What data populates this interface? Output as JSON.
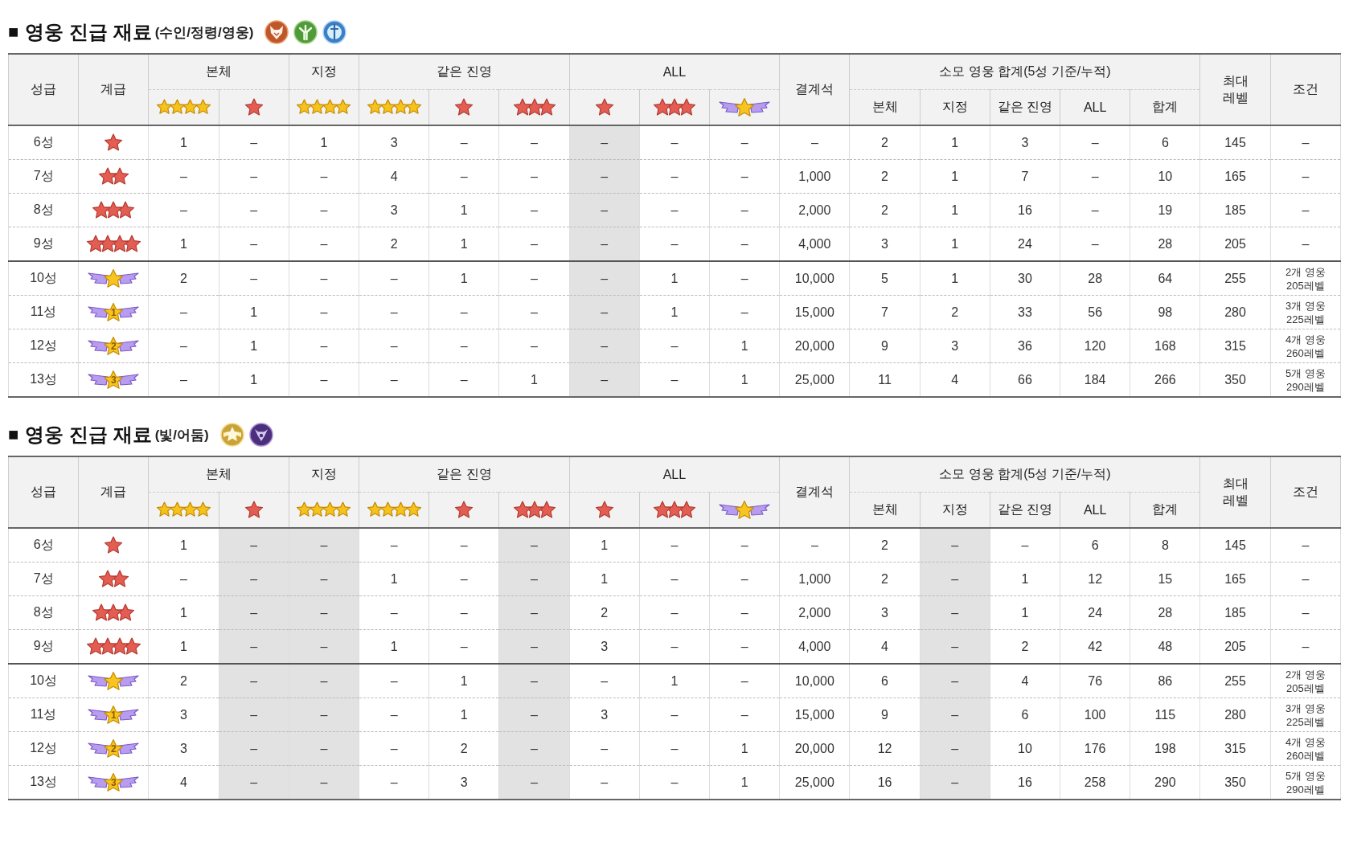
{
  "sections": [
    {
      "bullet": "■",
      "title": "영웅 진급 재료",
      "subtitle": "(수인/정령/영웅)",
      "emblems": [
        {
          "kind": "beast"
        },
        {
          "kind": "forest"
        },
        {
          "kind": "shield"
        }
      ],
      "table": {
        "grade": "성급",
        "rank": "계급",
        "groups": [
          {
            "label": "본체",
            "columns": [
              {
                "kind": "gold-4",
                "shaded": false
              },
              {
                "kind": "red-1",
                "shaded": false
              }
            ]
          },
          {
            "label": "지정",
            "columns": [
              {
                "kind": "gold-4",
                "shaded": false
              }
            ]
          },
          {
            "label": "같은 진영",
            "columns": [
              {
                "kind": "gold-4",
                "shaded": false
              },
              {
                "kind": "red-1",
                "shaded": false
              },
              {
                "kind": "red-3",
                "shaded": false
              }
            ]
          },
          {
            "label": "ALL",
            "columns": [
              {
                "kind": "red-1",
                "shaded": true
              },
              {
                "kind": "red-3",
                "shaded": false
              },
              {
                "kind": "wing",
                "shaded": false
              }
            ]
          }
        ],
        "crystal": "결계석",
        "totals": {
          "label": "소모 영웅 합계(5성 기준/누적)",
          "columns": [
            {
              "label": "본체",
              "shaded": false
            },
            {
              "label": "지정",
              "shaded": false
            },
            {
              "label": "같은 진영",
              "shaded": false
            },
            {
              "label": "ALL",
              "shaded": false
            },
            {
              "label": "합계",
              "shaded": false
            }
          ]
        },
        "max_level": [
          "최대",
          "레벨"
        ],
        "condition": "조건",
        "row_groups": [
          {
            "rows": [
              {
                "grade": "6성",
                "rank": {
                  "kind": "red-1"
                },
                "materials": [
                  "1",
                  "–",
                  "1",
                  "3",
                  "–",
                  "–",
                  "–",
                  "–",
                  "–"
                ],
                "crystal": "–",
                "totals": [
                  "2",
                  "1",
                  "3",
                  "–",
                  "6"
                ],
                "max_level": "145",
                "condition": [
                  "–"
                ]
              },
              {
                "grade": "7성",
                "rank": {
                  "kind": "red-2"
                },
                "materials": [
                  "–",
                  "–",
                  "–",
                  "4",
                  "–",
                  "–",
                  "–",
                  "–",
                  "–"
                ],
                "crystal": "1,000",
                "totals": [
                  "2",
                  "1",
                  "7",
                  "–",
                  "10"
                ],
                "max_level": "165",
                "condition": [
                  "–"
                ]
              },
              {
                "grade": "8성",
                "rank": {
                  "kind": "red-3"
                },
                "materials": [
                  "–",
                  "–",
                  "–",
                  "3",
                  "1",
                  "–",
                  "–",
                  "–",
                  "–"
                ],
                "crystal": "2,000",
                "totals": [
                  "2",
                  "1",
                  "16",
                  "–",
                  "19"
                ],
                "max_level": "185",
                "condition": [
                  "–"
                ]
              },
              {
                "grade": "9성",
                "rank": {
                  "kind": "red-4"
                },
                "materials": [
                  "1",
                  "–",
                  "–",
                  "2",
                  "1",
                  "–",
                  "–",
                  "–",
                  "–"
                ],
                "crystal": "4,000",
                "totals": [
                  "3",
                  "1",
                  "24",
                  "–",
                  "28"
                ],
                "max_level": "205",
                "condition": [
                  "–"
                ]
              }
            ]
          },
          {
            "rows": [
              {
                "grade": "10성",
                "rank": {
                  "kind": "wing"
                },
                "materials": [
                  "2",
                  "–",
                  "–",
                  "–",
                  "1",
                  "–",
                  "–",
                  "1",
                  "–"
                ],
                "crystal": "10,000",
                "totals": [
                  "5",
                  "1",
                  "30",
                  "28",
                  "64"
                ],
                "max_level": "255",
                "condition": [
                  "2개 영웅",
                  "205레벨"
                ]
              },
              {
                "grade": "11성",
                "rank": {
                  "kind": "wing",
                  "number": "1"
                },
                "materials": [
                  "–",
                  "1",
                  "–",
                  "–",
                  "–",
                  "–",
                  "–",
                  "1",
                  "–"
                ],
                "crystal": "15,000",
                "totals": [
                  "7",
                  "2",
                  "33",
                  "56",
                  "98"
                ],
                "max_level": "280",
                "condition": [
                  "3개 영웅",
                  "225레벨"
                ]
              },
              {
                "grade": "12성",
                "rank": {
                  "kind": "wing",
                  "number": "2"
                },
                "materials": [
                  "–",
                  "1",
                  "–",
                  "–",
                  "–",
                  "–",
                  "–",
                  "–",
                  "1"
                ],
                "crystal": "20,000",
                "totals": [
                  "9",
                  "3",
                  "36",
                  "120",
                  "168"
                ],
                "max_level": "315",
                "condition": [
                  "4개 영웅",
                  "260레벨"
                ]
              },
              {
                "grade": "13성",
                "rank": {
                  "kind": "wing",
                  "number": "3"
                },
                "materials": [
                  "–",
                  "1",
                  "–",
                  "–",
                  "–",
                  "1",
                  "–",
                  "–",
                  "1"
                ],
                "crystal": "25,000",
                "totals": [
                  "11",
                  "4",
                  "66",
                  "184",
                  "266"
                ],
                "max_level": "350",
                "condition": [
                  "5개 영웅",
                  "290레벨"
                ]
              }
            ]
          }
        ]
      }
    },
    {
      "bullet": "■",
      "title": "영웅 진급 재료",
      "subtitle": "(빛/어둠)",
      "emblems": [
        {
          "kind": "light"
        },
        {
          "kind": "dark"
        }
      ],
      "table": {
        "grade": "성급",
        "rank": "계급",
        "groups": [
          {
            "label": "본체",
            "columns": [
              {
                "kind": "gold-4",
                "shaded": false
              },
              {
                "kind": "red-1",
                "shaded": true
              }
            ]
          },
          {
            "label": "지정",
            "columns": [
              {
                "kind": "gold-4",
                "shaded": true
              }
            ]
          },
          {
            "label": "같은 진영",
            "columns": [
              {
                "kind": "gold-4",
                "shaded": false
              },
              {
                "kind": "red-1",
                "shaded": false
              },
              {
                "kind": "red-3",
                "shaded": true
              }
            ]
          },
          {
            "label": "ALL",
            "columns": [
              {
                "kind": "red-1",
                "shaded": false
              },
              {
                "kind": "red-3",
                "shaded": false
              },
              {
                "kind": "wing",
                "shaded": false
              }
            ]
          }
        ],
        "crystal": "결계석",
        "totals": {
          "label": "소모 영웅 합계(5성 기준/누적)",
          "columns": [
            {
              "label": "본체",
              "shaded": false
            },
            {
              "label": "지정",
              "shaded": true
            },
            {
              "label": "같은 진영",
              "shaded": false
            },
            {
              "label": "ALL",
              "shaded": false
            },
            {
              "label": "합계",
              "shaded": false
            }
          ]
        },
        "max_level": [
          "최대",
          "레벨"
        ],
        "condition": "조건",
        "row_groups": [
          {
            "rows": [
              {
                "grade": "6성",
                "rank": {
                  "kind": "red-1"
                },
                "materials": [
                  "1",
                  "–",
                  "–",
                  "–",
                  "–",
                  "–",
                  "1",
                  "–",
                  "–"
                ],
                "crystal": "–",
                "totals": [
                  "2",
                  "–",
                  "–",
                  "6",
                  "8"
                ],
                "max_level": "145",
                "condition": [
                  "–"
                ]
              },
              {
                "grade": "7성",
                "rank": {
                  "kind": "red-2"
                },
                "materials": [
                  "–",
                  "–",
                  "–",
                  "1",
                  "–",
                  "–",
                  "1",
                  "–",
                  "–"
                ],
                "crystal": "1,000",
                "totals": [
                  "2",
                  "–",
                  "1",
                  "12",
                  "15"
                ],
                "max_level": "165",
                "condition": [
                  "–"
                ]
              },
              {
                "grade": "8성",
                "rank": {
                  "kind": "red-3"
                },
                "materials": [
                  "1",
                  "–",
                  "–",
                  "–",
                  "–",
                  "–",
                  "2",
                  "–",
                  "–"
                ],
                "crystal": "2,000",
                "totals": [
                  "3",
                  "–",
                  "1",
                  "24",
                  "28"
                ],
                "max_level": "185",
                "condition": [
                  "–"
                ]
              },
              {
                "grade": "9성",
                "rank": {
                  "kind": "red-4"
                },
                "materials": [
                  "1",
                  "–",
                  "–",
                  "1",
                  "–",
                  "–",
                  "3",
                  "–",
                  "–"
                ],
                "crystal": "4,000",
                "totals": [
                  "4",
                  "–",
                  "2",
                  "42",
                  "48"
                ],
                "max_level": "205",
                "condition": [
                  "–"
                ]
              }
            ]
          },
          {
            "rows": [
              {
                "grade": "10성",
                "rank": {
                  "kind": "wing"
                },
                "materials": [
                  "2",
                  "–",
                  "–",
                  "–",
                  "1",
                  "–",
                  "–",
                  "1",
                  "–"
                ],
                "crystal": "10,000",
                "totals": [
                  "6",
                  "–",
                  "4",
                  "76",
                  "86"
                ],
                "max_level": "255",
                "condition": [
                  "2개 영웅",
                  "205레벨"
                ]
              },
              {
                "grade": "11성",
                "rank": {
                  "kind": "wing",
                  "number": "1"
                },
                "materials": [
                  "3",
                  "–",
                  "–",
                  "–",
                  "1",
                  "–",
                  "3",
                  "–",
                  "–"
                ],
                "crystal": "15,000",
                "totals": [
                  "9",
                  "–",
                  "6",
                  "100",
                  "115"
                ],
                "max_level": "280",
                "condition": [
                  "3개 영웅",
                  "225레벨"
                ]
              },
              {
                "grade": "12성",
                "rank": {
                  "kind": "wing",
                  "number": "2"
                },
                "materials": [
                  "3",
                  "–",
                  "–",
                  "–",
                  "2",
                  "–",
                  "–",
                  "–",
                  "1"
                ],
                "crystal": "20,000",
                "totals": [
                  "12",
                  "–",
                  "10",
                  "176",
                  "198"
                ],
                "max_level": "315",
                "condition": [
                  "4개 영웅",
                  "260레벨"
                ]
              },
              {
                "grade": "13성",
                "rank": {
                  "kind": "wing",
                  "number": "3"
                },
                "materials": [
                  "4",
                  "–",
                  "–",
                  "–",
                  "3",
                  "–",
                  "–",
                  "–",
                  "1"
                ],
                "crystal": "25,000",
                "totals": [
                  "16",
                  "–",
                  "16",
                  "258",
                  "290"
                ],
                "max_level": "350",
                "condition": [
                  "5개 영웅",
                  "290레벨"
                ]
              }
            ]
          }
        ]
      }
    }
  ]
}
